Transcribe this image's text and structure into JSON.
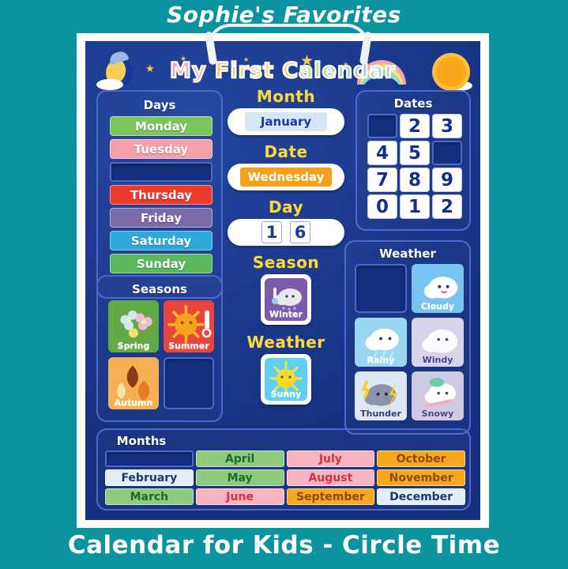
{
  "overlay": {
    "top_caption": "Sophie's Favorites",
    "bottom_caption": "Calendar for Kids - Circle Time"
  },
  "board": {
    "banner_title": "My First Calendar",
    "background_color": "#19379c",
    "page_background_color": "#0b94a0",
    "decor": [
      "moon-icon",
      "star-icon",
      "rainbow-icon",
      "sun-icon",
      "cloud-icon"
    ]
  },
  "days": {
    "title": "Days",
    "items": [
      {
        "label": "Monday",
        "color": "#7cc45e",
        "filled": true
      },
      {
        "label": "Tuesday",
        "color": "#f4a0ab",
        "filled": true
      },
      {
        "label": "",
        "color": "#16307f",
        "filled": false
      },
      {
        "label": "Thursday",
        "color": "#ee3b2e",
        "filled": true
      },
      {
        "label": "Friday",
        "color": "#7a6aa8",
        "filled": true
      },
      {
        "label": "Saturday",
        "color": "#2fa8dc",
        "filled": true
      },
      {
        "label": "Sunday",
        "color": "#5cb85c",
        "filled": true
      }
    ]
  },
  "month_field": {
    "label": "Month",
    "value": "January",
    "value_bg": "#d6e6f4",
    "value_color": "#1b3a9c"
  },
  "date_field": {
    "label": "Date",
    "value": "Wednesday",
    "value_bg": "#f6a01a",
    "value_color": "#ffffff"
  },
  "day_field": {
    "label": "Day",
    "digits": [
      "1",
      "6"
    ]
  },
  "season_field": {
    "label": "Season",
    "value": "Winter",
    "card_bg": "#7a5ca8",
    "label_color": "#ffffff",
    "icon": "snow-cloud-thermometer-icon"
  },
  "weather_field": {
    "label": "Weather",
    "value": "Sunny",
    "card_bg": "#5fd0ef",
    "label_color": "#ffffff",
    "icon": "sun-icon"
  },
  "dates": {
    "title": "Dates",
    "rows": [
      [
        {
          "value": "",
          "filled": false
        },
        {
          "value": "2",
          "filled": true
        },
        {
          "value": "3",
          "filled": true
        }
      ],
      [
        {
          "value": "4",
          "filled": true
        },
        {
          "value": "5",
          "filled": true
        },
        {
          "value": "",
          "filled": false
        }
      ],
      [
        {
          "value": "7",
          "filled": true
        },
        {
          "value": "8",
          "filled": true
        },
        {
          "value": "9",
          "filled": true
        }
      ],
      [
        {
          "value": "0",
          "filled": true
        },
        {
          "value": "1",
          "filled": true
        },
        {
          "value": "2",
          "filled": true
        }
      ]
    ]
  },
  "weather_panel": {
    "title": "Weather",
    "items": [
      {
        "label": "",
        "bg": "#16307f",
        "filled": false,
        "icon": "empty-slot",
        "label_color": "#ffffff"
      },
      {
        "label": "Cloudy",
        "bg": "#76c4ef",
        "filled": true,
        "icon": "cloud-icon",
        "label_color": "#ffffff"
      },
      {
        "label": "Rainy",
        "bg": "#9ad7f2",
        "filled": true,
        "icon": "rain-cloud-icon",
        "label_color": "#ffffff"
      },
      {
        "label": "Windy",
        "bg": "#d6d3ea",
        "filled": true,
        "icon": "wind-cloud-icon",
        "label_color": "#45408c"
      },
      {
        "label": "Thunder",
        "bg": "#dfe7f5",
        "filled": true,
        "icon": "thunder-cloud-icon",
        "label_color": "#3a3a6a"
      },
      {
        "label": "Snowy",
        "bg": "#cfc9e2",
        "filled": true,
        "icon": "snow-cloud-icon",
        "label_color": "#4b3f86"
      }
    ]
  },
  "seasons_panel": {
    "title": "Seasons",
    "items": [
      {
        "label": "Spring",
        "bg": "#63a945",
        "filled": true,
        "icon": "flowers-icon",
        "label_color": "#ffffff"
      },
      {
        "label": "Summer",
        "bg": "#e8453c",
        "filled": true,
        "icon": "sun-thermometer-icon",
        "label_color": "#ffffff"
      },
      {
        "label": "Autumn",
        "bg": "#f5b055",
        "filled": true,
        "icon": "leaves-icon",
        "label_color": "#ffffff"
      },
      {
        "label": "",
        "bg": "#16307f",
        "filled": false,
        "icon": "empty-slot",
        "label_color": "#ffffff"
      }
    ]
  },
  "months_panel": {
    "title": "Months",
    "items": [
      {
        "label": "",
        "bg": "#16307f",
        "color": "#16307f",
        "filled": false
      },
      {
        "label": "April",
        "bg": "#8fca7e",
        "color": "#1d6b2a",
        "filled": true
      },
      {
        "label": "July",
        "bg": "#f7b5c0",
        "color": "#d6303f",
        "filled": true
      },
      {
        "label": "October",
        "bg": "#f8a81c",
        "color": "#8a4a10",
        "filled": true
      },
      {
        "label": "February",
        "bg": "#e2eef8",
        "color": "#1b3a6b",
        "filled": true
      },
      {
        "label": "May",
        "bg": "#8fca7e",
        "color": "#1d6b2a",
        "filled": true
      },
      {
        "label": "August",
        "bg": "#f7b5c0",
        "color": "#d6303f",
        "filled": true
      },
      {
        "label": "November",
        "bg": "#f8a81c",
        "color": "#8a4a10",
        "filled": true
      },
      {
        "label": "March",
        "bg": "#8fca7e",
        "color": "#1d6b2a",
        "filled": true
      },
      {
        "label": "June",
        "bg": "#f7b5c0",
        "color": "#d6303f",
        "filled": true
      },
      {
        "label": "September",
        "bg": "#f8a81c",
        "color": "#8a4a10",
        "filled": true
      },
      {
        "label": "December",
        "bg": "#e2eef8",
        "color": "#1b3a6b",
        "filled": true
      }
    ]
  }
}
